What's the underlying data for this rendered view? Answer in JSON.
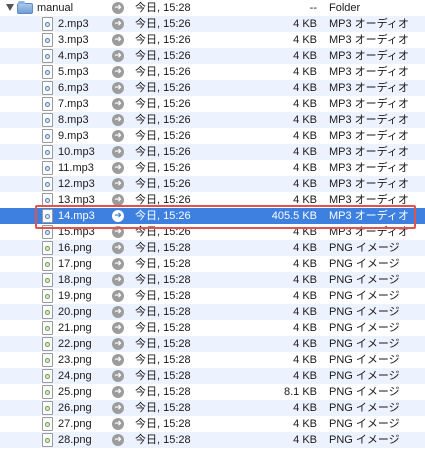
{
  "folder": {
    "name": "manual",
    "date": "今日, 15:28",
    "size": "--",
    "kind": "Folder"
  },
  "files": [
    {
      "name": "2.mp3",
      "date": "今日, 15:26",
      "size": "4 KB",
      "kind": "MP3 オーディオ",
      "type": "mp3"
    },
    {
      "name": "3.mp3",
      "date": "今日, 15:26",
      "size": "4 KB",
      "kind": "MP3 オーディオ",
      "type": "mp3"
    },
    {
      "name": "4.mp3",
      "date": "今日, 15:26",
      "size": "4 KB",
      "kind": "MP3 オーディオ",
      "type": "mp3"
    },
    {
      "name": "5.mp3",
      "date": "今日, 15:26",
      "size": "4 KB",
      "kind": "MP3 オーディオ",
      "type": "mp3"
    },
    {
      "name": "6.mp3",
      "date": "今日, 15:26",
      "size": "4 KB",
      "kind": "MP3 オーディオ",
      "type": "mp3"
    },
    {
      "name": "7.mp3",
      "date": "今日, 15:26",
      "size": "4 KB",
      "kind": "MP3 オーディオ",
      "type": "mp3"
    },
    {
      "name": "8.mp3",
      "date": "今日, 15:26",
      "size": "4 KB",
      "kind": "MP3 オーディオ",
      "type": "mp3"
    },
    {
      "name": "9.mp3",
      "date": "今日, 15:26",
      "size": "4 KB",
      "kind": "MP3 オーディオ",
      "type": "mp3"
    },
    {
      "name": "10.mp3",
      "date": "今日, 15:26",
      "size": "4 KB",
      "kind": "MP3 オーディオ",
      "type": "mp3"
    },
    {
      "name": "11.mp3",
      "date": "今日, 15:26",
      "size": "4 KB",
      "kind": "MP3 オーディオ",
      "type": "mp3"
    },
    {
      "name": "12.mp3",
      "date": "今日, 15:26",
      "size": "4 KB",
      "kind": "MP3 オーディオ",
      "type": "mp3"
    },
    {
      "name": "13.mp3",
      "date": "今日, 15:26",
      "size": "4 KB",
      "kind": "MP3 オーディオ",
      "type": "mp3"
    },
    {
      "name": "14.mp3",
      "date": "今日, 15:26",
      "size": "405.5 KB",
      "kind": "MP3 オーディオ",
      "type": "mp3",
      "selected": true
    },
    {
      "name": "15.mp3",
      "date": "今日, 15:26",
      "size": "4 KB",
      "kind": "MP3 オーディオ",
      "type": "mp3"
    },
    {
      "name": "16.png",
      "date": "今日, 15:28",
      "size": "4 KB",
      "kind": "PNG イメージ",
      "type": "png"
    },
    {
      "name": "17.png",
      "date": "今日, 15:28",
      "size": "4 KB",
      "kind": "PNG イメージ",
      "type": "png"
    },
    {
      "name": "18.png",
      "date": "今日, 15:28",
      "size": "4 KB",
      "kind": "PNG イメージ",
      "type": "png"
    },
    {
      "name": "19.png",
      "date": "今日, 15:28",
      "size": "4 KB",
      "kind": "PNG イメージ",
      "type": "png"
    },
    {
      "name": "20.png",
      "date": "今日, 15:28",
      "size": "4 KB",
      "kind": "PNG イメージ",
      "type": "png"
    },
    {
      "name": "21.png",
      "date": "今日, 15:28",
      "size": "4 KB",
      "kind": "PNG イメージ",
      "type": "png"
    },
    {
      "name": "22.png",
      "date": "今日, 15:28",
      "size": "4 KB",
      "kind": "PNG イメージ",
      "type": "png"
    },
    {
      "name": "23.png",
      "date": "今日, 15:28",
      "size": "4 KB",
      "kind": "PNG イメージ",
      "type": "png"
    },
    {
      "name": "24.png",
      "date": "今日, 15:28",
      "size": "4 KB",
      "kind": "PNG イメージ",
      "type": "png"
    },
    {
      "name": "25.png",
      "date": "今日, 15:28",
      "size": "8.1 KB",
      "kind": "PNG イメージ",
      "type": "png"
    },
    {
      "name": "26.png",
      "date": "今日, 15:28",
      "size": "4 KB",
      "kind": "PNG イメージ",
      "type": "png"
    },
    {
      "name": "27.png",
      "date": "今日, 15:28",
      "size": "4 KB",
      "kind": "PNG イメージ",
      "type": "png"
    },
    {
      "name": "28.png",
      "date": "今日, 15:28",
      "size": "4 KB",
      "kind": "PNG イメージ",
      "type": "png"
    }
  ],
  "colors": {
    "selection": "#3d80df",
    "highlight_outline": "#e2534b",
    "alternate_row": "#edf3fe"
  },
  "icons": {
    "disclosure": "disclosure-triangle-icon",
    "folder": "folder-icon",
    "file": "document-icon",
    "go_to": "arrow-circle-icon"
  }
}
